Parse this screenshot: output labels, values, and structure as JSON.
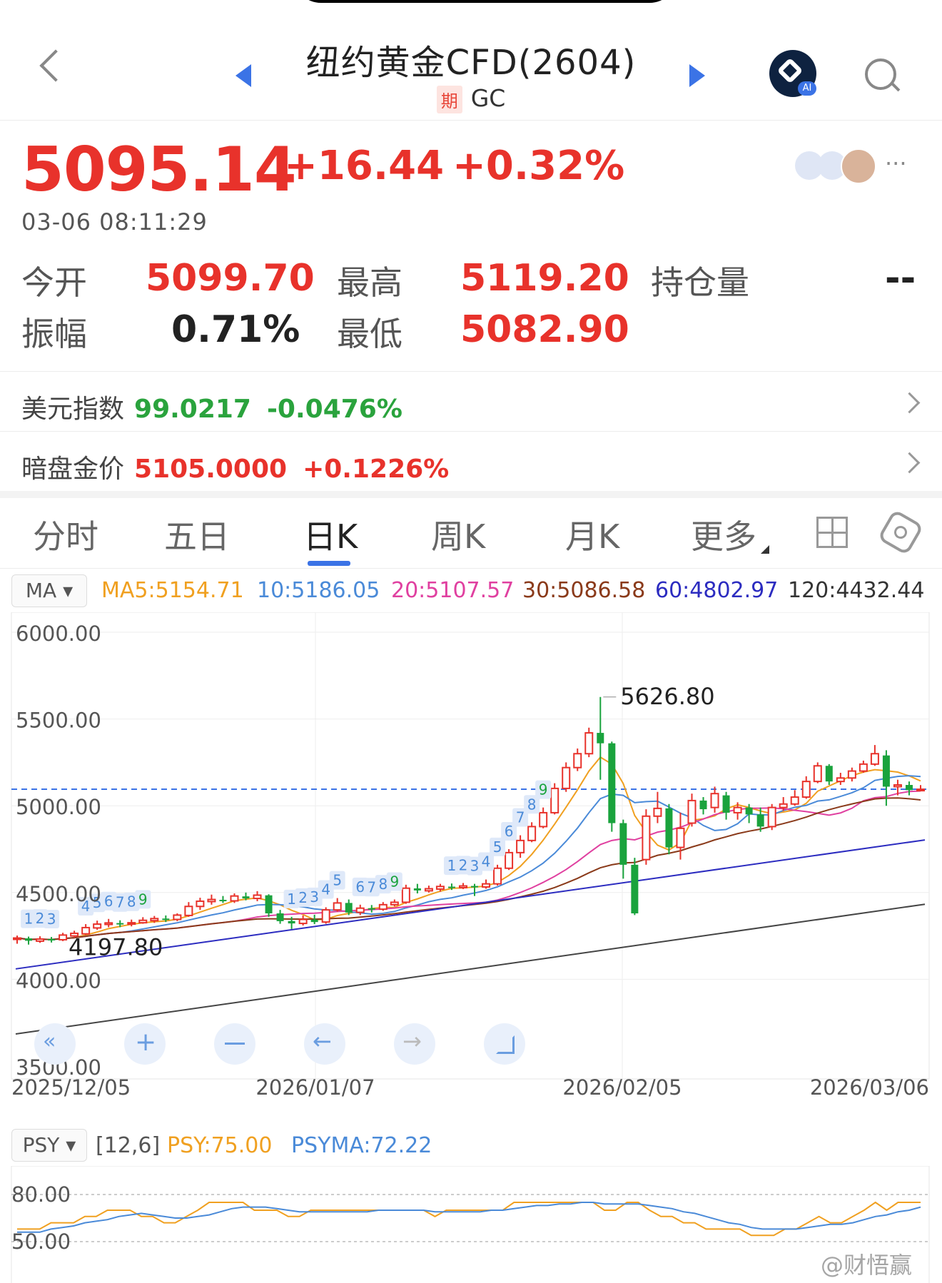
{
  "header": {
    "title": "纽约黄金CFD(2604)",
    "tag": "期",
    "code": "GC"
  },
  "quote": {
    "price": "5095.14",
    "change": "+16.44",
    "change_pct": "+0.32%",
    "timestamp": "03-06 08:11:29"
  },
  "stats": {
    "open_label": "今开",
    "open": "5099.70",
    "high_label": "最高",
    "high": "5119.20",
    "oi_label": "持仓量",
    "oi": "--",
    "amp_label": "振幅",
    "amp": "0.71%",
    "low_label": "最低",
    "low": "5082.90"
  },
  "links": [
    {
      "label": "美元指数",
      "value": "99.0217",
      "pct": "-0.0476%"
    },
    {
      "label": "暗盘金价",
      "value": "5105.0000",
      "pct": "+0.1226%"
    }
  ],
  "tabs": [
    "分时",
    "五日",
    "日K",
    "周K",
    "月K",
    "更多"
  ],
  "active_tab": "日K",
  "ma_bar": {
    "button": "MA",
    "items": [
      {
        "text": "MA5:5154.71",
        "color": "#f0a020"
      },
      {
        "text": "10:5186.05",
        "color": "#4a8ad8"
      },
      {
        "text": "20:5107.57",
        "color": "#e040a0"
      },
      {
        "text": "30:5086.58",
        "color": "#8a3a1a"
      },
      {
        "text": "60:4802.97",
        "color": "#2c2cc0"
      },
      {
        "text": "120:4432.44",
        "color": "#333333"
      }
    ]
  },
  "psy_bar": {
    "button": "PSY",
    "params": "[12,6]",
    "psy": "PSY:75.00",
    "psyma": "PSYMA:72.22"
  },
  "watermark": "@财悟赢",
  "colors": {
    "up": "#e8322b",
    "down": "#1aa33d",
    "accent": "#3b73e6"
  },
  "icons": [
    "back-icon",
    "prev-arrow-icon",
    "next-arrow-icon",
    "ai-icon",
    "search-icon",
    "weibo-icon",
    "more-icon",
    "grid-icon",
    "settings-icon"
  ],
  "chart_data": [
    {
      "type": "candlestick",
      "title": "",
      "y_ticks": [
        "6000.00",
        "5500.00",
        "5000.00",
        "4500.00",
        "4000.00",
        "3500.00"
      ],
      "ylim": [
        3500,
        6000
      ],
      "x_ticks": [
        "2025/12/05",
        "2026/01/07",
        "2026/02/05",
        "2026/03/06"
      ],
      "current_line": 5095.14,
      "annotations": {
        "max_label": "5626.80",
        "max_value": 5626.8,
        "min_label": "4197.80",
        "min_value": 4197.8
      },
      "candles": [
        [
          4230,
          4238,
          4205,
          4252
        ],
        [
          4236,
          4222,
          4200,
          4246
        ],
        [
          4220,
          4232,
          4210,
          4248
        ],
        [
          4232,
          4226,
          4212,
          4244
        ],
        [
          4228,
          4255,
          4220,
          4268
        ],
        [
          4250,
          4265,
          4240,
          4280
        ],
        [
          4262,
          4298,
          4255,
          4318
        ],
        [
          4296,
          4318,
          4285,
          4338
        ],
        [
          4316,
          4325,
          4300,
          4348
        ],
        [
          4324,
          4318,
          4300,
          4340
        ],
        [
          4318,
          4326,
          4305,
          4344
        ],
        [
          4326,
          4340,
          4320,
          4358
        ],
        [
          4338,
          4350,
          4325,
          4365
        ],
        [
          4350,
          4347,
          4330,
          4368
        ],
        [
          4345,
          4370,
          4335,
          4380
        ],
        [
          4368,
          4420,
          4360,
          4445
        ],
        [
          4420,
          4450,
          4400,
          4470
        ],
        [
          4448,
          4460,
          4430,
          4488
        ],
        [
          4458,
          4452,
          4440,
          4480
        ],
        [
          4452,
          4480,
          4440,
          4495
        ],
        [
          4478,
          4466,
          4455,
          4500
        ],
        [
          4466,
          4485,
          4450,
          4508
        ],
        [
          4484,
          4380,
          4360,
          4490
        ],
        [
          4380,
          4335,
          4320,
          4400
        ],
        [
          4336,
          4322,
          4290,
          4360
        ],
        [
          4322,
          4345,
          4310,
          4368
        ],
        [
          4344,
          4330,
          4318,
          4372
        ],
        [
          4330,
          4400,
          4320,
          4415
        ],
        [
          4400,
          4440,
          4390,
          4468
        ],
        [
          4440,
          4385,
          4370,
          4460
        ],
        [
          4386,
          4410,
          4370,
          4430
        ],
        [
          4410,
          4405,
          4385,
          4428
        ],
        [
          4404,
          4430,
          4395,
          4445
        ],
        [
          4430,
          4444,
          4420,
          4460
        ],
        [
          4444,
          4525,
          4435,
          4545
        ],
        [
          4524,
          4512,
          4495,
          4550
        ],
        [
          4510,
          4522,
          4500,
          4540
        ],
        [
          4520,
          4535,
          4505,
          4550
        ],
        [
          4534,
          4528,
          4515,
          4552
        ],
        [
          4528,
          4538,
          4520,
          4555
        ],
        [
          4538,
          4535,
          4480,
          4550
        ],
        [
          4532,
          4550,
          4522,
          4575
        ],
        [
          4550,
          4640,
          4540,
          4660
        ],
        [
          4640,
          4730,
          4630,
          4750
        ],
        [
          4730,
          4800,
          4700,
          4830
        ],
        [
          4800,
          4880,
          4790,
          4905
        ],
        [
          4880,
          4960,
          4870,
          4990
        ],
        [
          4960,
          5100,
          4950,
          5130
        ],
        [
          5100,
          5220,
          5080,
          5250
        ],
        [
          5220,
          5300,
          5200,
          5330
        ],
        [
          5300,
          5420,
          5280,
          5450
        ],
        [
          5420,
          5360,
          5150,
          5626.8
        ],
        [
          5360,
          4900,
          4850,
          5370
        ],
        [
          4900,
          4660,
          4580,
          4920
        ],
        [
          4660,
          4380,
          4370,
          4700
        ],
        [
          4690,
          4940,
          4660,
          4980
        ],
        [
          4940,
          4985,
          4900,
          5080
        ],
        [
          4985,
          4760,
          4720,
          5010
        ],
        [
          4760,
          4870,
          4690,
          4960
        ],
        [
          4900,
          5030,
          4880,
          5070
        ],
        [
          5030,
          4980,
          4950,
          5050
        ],
        [
          4990,
          5070,
          4960,
          5110
        ],
        [
          5060,
          4960,
          4920,
          5080
        ],
        [
          4960,
          4990,
          4920,
          5020
        ],
        [
          4990,
          4950,
          4900,
          5010
        ],
        [
          4950,
          4880,
          4850,
          4990
        ],
        [
          4880,
          4990,
          4860,
          5010
        ],
        [
          4990,
          5010,
          4970,
          5050
        ],
        [
          5010,
          5050,
          5000,
          5090
        ],
        [
          5050,
          5140,
          5040,
          5170
        ],
        [
          5140,
          5230,
          5130,
          5250
        ],
        [
          5230,
          5140,
          5120,
          5240
        ],
        [
          5140,
          5160,
          5120,
          5190
        ],
        [
          5160,
          5200,
          5140,
          5220
        ],
        [
          5200,
          5240,
          5190,
          5260
        ],
        [
          5240,
          5300,
          5230,
          5350
        ],
        [
          5290,
          5110,
          5000,
          5320
        ],
        [
          5110,
          5120,
          5060,
          5150
        ],
        [
          5120,
          5090,
          5060,
          5140
        ],
        [
          5090,
          5095.14,
          5082.9,
          5119.2
        ]
      ],
      "seq_labels": [
        {
          "i": 1,
          "t": "1"
        },
        {
          "i": 2,
          "t": "2"
        },
        {
          "i": 3,
          "t": "3"
        },
        {
          "i": 6,
          "t": "4"
        },
        {
          "i": 7,
          "t": "5"
        },
        {
          "i": 8,
          "t": "6"
        },
        {
          "i": 9,
          "t": "7"
        },
        {
          "i": 10,
          "t": "8"
        },
        {
          "i": 11,
          "t": "9"
        },
        {
          "i": 24,
          "t": "1"
        },
        {
          "i": 25,
          "t": "2"
        },
        {
          "i": 26,
          "t": "3"
        },
        {
          "i": 27,
          "t": "4"
        },
        {
          "i": 28,
          "t": "5"
        },
        {
          "i": 30,
          "t": "6"
        },
        {
          "i": 31,
          "t": "7"
        },
        {
          "i": 32,
          "t": "8"
        },
        {
          "i": 33,
          "t": "9"
        },
        {
          "i": 38,
          "t": "1"
        },
        {
          "i": 39,
          "t": "2"
        },
        {
          "i": 40,
          "t": "3"
        },
        {
          "i": 41,
          "t": "4"
        },
        {
          "i": 42,
          "t": "5"
        },
        {
          "i": 43,
          "t": "6"
        },
        {
          "i": 44,
          "t": "7"
        },
        {
          "i": 45,
          "t": "8"
        },
        {
          "i": 46,
          "t": "9"
        }
      ]
    },
    {
      "type": "line",
      "title": "PSY",
      "y_ticks": [
        "80.00",
        "50.00"
      ],
      "ylim": [
        40,
        90
      ],
      "series": [
        {
          "name": "PSY",
          "color": "#f0a020",
          "values": [
            58,
            58,
            58,
            62,
            62,
            62,
            66,
            66,
            70,
            70,
            70,
            66,
            66,
            62,
            62,
            66,
            70,
            75,
            75,
            75,
            75,
            70,
            70,
            70,
            66,
            66,
            70,
            70,
            70,
            70,
            70,
            70,
            70,
            70,
            70,
            70,
            70,
            66,
            70,
            70,
            70,
            70,
            70,
            70,
            75,
            75,
            75,
            75,
            75,
            75,
            75,
            75,
            70,
            70,
            75,
            75,
            70,
            66,
            66,
            62,
            62,
            58,
            58,
            58,
            58,
            54,
            54,
            54,
            58,
            58,
            62,
            66,
            62,
            62,
            66,
            70,
            75,
            70,
            75,
            75,
            75
          ]
        },
        {
          "name": "PSYMA",
          "color": "#4a8ad8",
          "values": [
            56,
            56,
            56,
            58,
            59,
            60,
            62,
            63,
            64,
            66,
            67,
            68,
            67,
            66,
            65,
            65,
            66,
            67,
            69,
            71,
            72,
            72,
            72,
            71,
            70,
            69,
            69,
            69,
            69,
            69,
            69,
            69,
            70,
            70,
            70,
            70,
            70,
            69,
            69,
            69,
            69,
            69,
            70,
            70,
            71,
            72,
            73,
            73,
            74,
            74,
            75,
            75,
            74,
            74,
            74,
            74,
            73,
            72,
            71,
            69,
            68,
            66,
            64,
            62,
            61,
            59,
            58,
            58,
            58,
            58,
            59,
            60,
            61,
            61,
            62,
            64,
            66,
            67,
            69,
            70,
            72
          ]
        }
      ]
    }
  ]
}
